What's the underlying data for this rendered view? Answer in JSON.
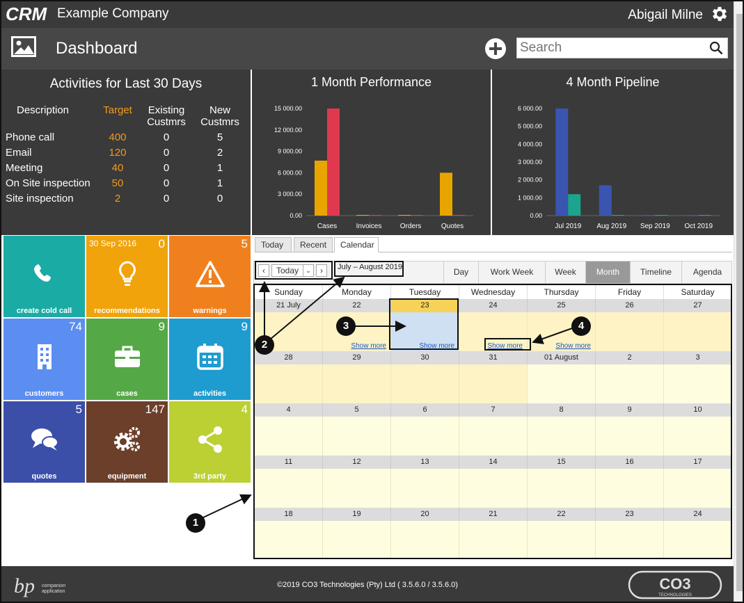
{
  "header": {
    "logo_text": "CRM",
    "company": "Example Company",
    "user": "Abigail Milne"
  },
  "dashbar": {
    "title": "Dashboard",
    "search_placeholder": "Search"
  },
  "activities": {
    "title": "Activities for Last 30 Days",
    "headers": [
      "Description",
      "Target",
      "Existing Custmrs",
      "New Custmrs"
    ],
    "rows": [
      {
        "desc": "Phone call",
        "target": "400",
        "existing": "0",
        "new": "5"
      },
      {
        "desc": "Email",
        "target": "120",
        "existing": "0",
        "new": "2"
      },
      {
        "desc": "Meeting",
        "target": "40",
        "existing": "0",
        "new": "1"
      },
      {
        "desc": "On Site inspection",
        "target": "50",
        "existing": "0",
        "new": "1"
      },
      {
        "desc": "Site inspection",
        "target": "2",
        "existing": "0",
        "new": "0"
      }
    ]
  },
  "chart_data": [
    {
      "type": "bar",
      "title": "1 Month Performance",
      "categories": [
        "Cases",
        "Invoices",
        "Orders",
        "Quotes"
      ],
      "ylim": [
        0,
        15000
      ],
      "yticks": [
        "0.00",
        "3 000.00",
        "6 000.00",
        "9 000.00",
        "12 000.00",
        "15 000.00"
      ],
      "series": [
        {
          "color": "#e8a500",
          "values": [
            7700,
            0,
            0,
            6000
          ]
        },
        {
          "color": "#e0394f",
          "values": [
            15000,
            0,
            0,
            0
          ]
        }
      ]
    },
    {
      "type": "bar",
      "title": "4 Month Pipeline",
      "categories": [
        "Jul 2019",
        "Aug 2019",
        "Sep 2019",
        "Oct 2019"
      ],
      "ylim": [
        0,
        6000
      ],
      "yticks": [
        "0.00",
        "1 000.00",
        "2 000.00",
        "3 000.00",
        "4 000.00",
        "5 000.00",
        "6 000.00"
      ],
      "series": [
        {
          "color": "#3a55b0",
          "values": [
            6000,
            1700,
            0,
            0
          ]
        },
        {
          "color": "#1aa58c",
          "values": [
            1200,
            0,
            0,
            0
          ]
        }
      ]
    }
  ],
  "tiles": [
    {
      "label": "create cold call",
      "count": "",
      "color": "#1aaba4",
      "icon": "phone-icon"
    },
    {
      "label": "recommendations",
      "count": "0",
      "date": "30 Sep 2016",
      "color": "#f0a30a",
      "icon": "lightbulb-icon"
    },
    {
      "label": "warnings",
      "count": "5",
      "color": "#f0801e",
      "icon": "warning-icon"
    },
    {
      "label": "customers",
      "count": "74",
      "color": "#5b8ef0",
      "icon": "building-icon"
    },
    {
      "label": "cases",
      "count": "9",
      "color": "#55a846",
      "icon": "briefcase-icon"
    },
    {
      "label": "activities",
      "count": "9",
      "color": "#1e9cd0",
      "icon": "calendar-icon"
    },
    {
      "label": "quotes",
      "count": "5",
      "color": "#3b4ea8",
      "icon": "chat-icon"
    },
    {
      "label": "equipment",
      "count": "147",
      "color": "#6b3f2a",
      "icon": "gears-icon"
    },
    {
      "label": "3rd party",
      "count": "4",
      "color": "#bcd034",
      "icon": "share-icon"
    }
  ],
  "tabs": [
    "Today",
    "Recent",
    "Calendar"
  ],
  "toolbar": {
    "today": "Today",
    "range": "July – August 2019",
    "views": [
      "Day",
      "Work Week",
      "Week",
      "Month",
      "Timeline",
      "Agenda"
    ],
    "active_view": "Month"
  },
  "calendar": {
    "days": [
      "Sunday",
      "Monday",
      "Tuesday",
      "Wednesday",
      "Thursday",
      "Friday",
      "Saturday"
    ],
    "weeks": [
      [
        "21 July",
        "22",
        "23",
        "24",
        "25",
        "26",
        "27"
      ],
      [
        "28",
        "29",
        "30",
        "31",
        "01 August",
        "2",
        "3"
      ],
      [
        "4",
        "5",
        "6",
        "7",
        "8",
        "9",
        "10"
      ],
      [
        "11",
        "12",
        "13",
        "14",
        "15",
        "16",
        "17"
      ],
      [
        "18",
        "19",
        "20",
        "21",
        "22",
        "23",
        "24"
      ]
    ],
    "show_more": "Show more"
  },
  "callouts": [
    "1",
    "2",
    "3",
    "4"
  ],
  "footer": {
    "copyright": "©2019 CO3 Technologies (Pty) Ltd ( 3.5.6.0 / 3.5.6.0)",
    "left_logo_text": "bp companion application",
    "right_logo_text": "CO3 TECHNOLOGIES"
  }
}
